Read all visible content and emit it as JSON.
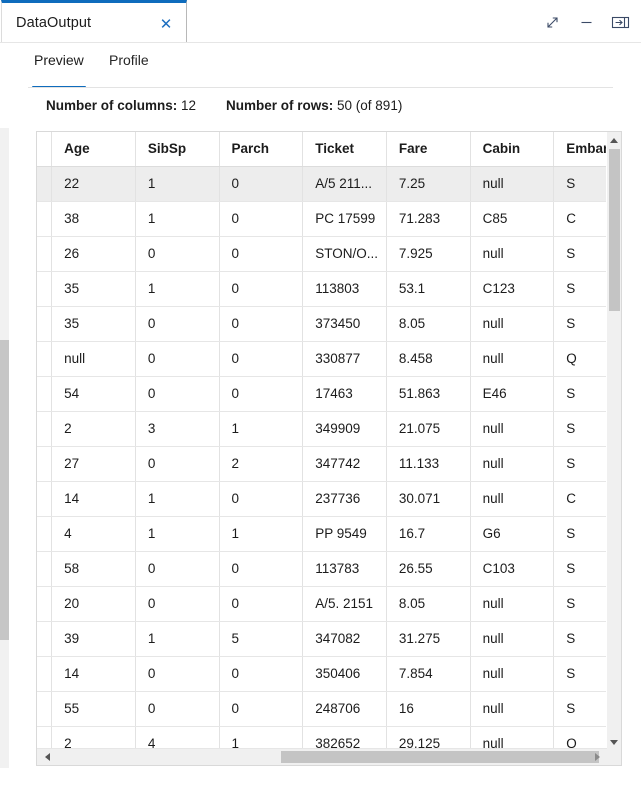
{
  "window": {
    "tab_title": "DataOutput",
    "close_label": "✕",
    "controls": [
      {
        "name": "expand-button",
        "icon": "expand-diagonal-icon"
      },
      {
        "name": "minimize-button",
        "icon": "minimize-icon"
      },
      {
        "name": "dock-button",
        "icon": "dock-right-icon"
      }
    ]
  },
  "subtabs": {
    "items": [
      {
        "label": "Preview",
        "active": true
      },
      {
        "label": "Profile",
        "active": false
      }
    ]
  },
  "info": {
    "columns_label": "Number of columns:",
    "columns_value": "12",
    "rows_label": "Number of rows:",
    "rows_value": "50 (of 891)"
  },
  "accent_color": "#0f6cbd",
  "selected_row_color": "#ededed",
  "grid": {
    "columns": [
      "",
      "Age",
      "SibSp",
      "Parch",
      "Ticket",
      "Fare",
      "Cabin",
      "Embark..."
    ],
    "selected_row_index": 0,
    "rows": [
      [
        "",
        "22",
        "1",
        "0",
        "A/5 211...",
        "7.25",
        "null",
        "S"
      ],
      [
        "",
        "38",
        "1",
        "0",
        "PC 17599",
        "71.283",
        "C85",
        "C"
      ],
      [
        "",
        "26",
        "0",
        "0",
        "STON/O...",
        "7.925",
        "null",
        "S"
      ],
      [
        "",
        "35",
        "1",
        "0",
        "113803",
        "53.1",
        "C123",
        "S"
      ],
      [
        "",
        "35",
        "0",
        "0",
        "373450",
        "8.05",
        "null",
        "S"
      ],
      [
        "",
        "null",
        "0",
        "0",
        "330877",
        "8.458",
        "null",
        "Q"
      ],
      [
        "",
        "54",
        "0",
        "0",
        "17463",
        "51.863",
        "E46",
        "S"
      ],
      [
        "",
        "2",
        "3",
        "1",
        "349909",
        "21.075",
        "null",
        "S"
      ],
      [
        "",
        "27",
        "0",
        "2",
        "347742",
        "11.133",
        "null",
        "S"
      ],
      [
        "",
        "14",
        "1",
        "0",
        "237736",
        "30.071",
        "null",
        "C"
      ],
      [
        "",
        "4",
        "1",
        "1",
        "PP 9549",
        "16.7",
        "G6",
        "S"
      ],
      [
        "",
        "58",
        "0",
        "0",
        "113783",
        "26.55",
        "C103",
        "S"
      ],
      [
        "",
        "20",
        "0",
        "0",
        "A/5. 2151",
        "8.05",
        "null",
        "S"
      ],
      [
        "",
        "39",
        "1",
        "5",
        "347082",
        "31.275",
        "null",
        "S"
      ],
      [
        "",
        "14",
        "0",
        "0",
        "350406",
        "7.854",
        "null",
        "S"
      ],
      [
        "",
        "55",
        "0",
        "0",
        "248706",
        "16",
        "null",
        "S"
      ],
      [
        "",
        "2",
        "4",
        "1",
        "382652",
        "29.125",
        "null",
        "Q"
      ]
    ]
  }
}
